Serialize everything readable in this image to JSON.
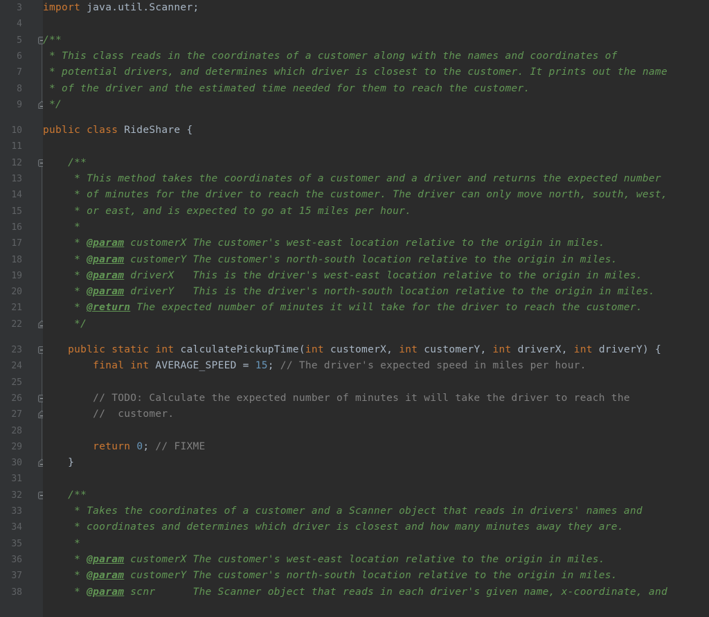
{
  "editor": {
    "language": "java",
    "theme": "darcula",
    "colors": {
      "background": "#2b2b2b",
      "gutter_background": "#313335",
      "line_number": "#606366",
      "keyword": "#cc7832",
      "identifier": "#a9b7c6",
      "number": "#6897bb",
      "javadoc": "#629755",
      "line_comment": "#808080",
      "fold_line": "#4e5254"
    },
    "first_visible_line": 3,
    "last_visible_line": 38
  },
  "gutter": {
    "line_numbers": [
      "3",
      "4",
      "5",
      "6",
      "7",
      "8",
      "9",
      "10",
      "11",
      "12",
      "13",
      "14",
      "15",
      "16",
      "17",
      "18",
      "19",
      "20",
      "21",
      "22",
      "23",
      "24",
      "25",
      "26",
      "27",
      "28",
      "29",
      "30",
      "31",
      "32",
      "33",
      "34",
      "35",
      "36",
      "37",
      "38"
    ],
    "fold_markers": [
      {
        "line": "5",
        "type": "fold-collapse-icon"
      },
      {
        "line": "9",
        "type": "fold-end-icon"
      },
      {
        "line": "12",
        "type": "fold-collapse-icon"
      },
      {
        "line": "22",
        "type": "fold-end-icon"
      },
      {
        "line": "23",
        "type": "fold-collapse-icon"
      },
      {
        "line": "26",
        "type": "fold-collapse-icon"
      },
      {
        "line": "27",
        "type": "fold-end-icon"
      },
      {
        "line": "30",
        "type": "fold-end-icon"
      },
      {
        "line": "32",
        "type": "fold-collapse-icon"
      }
    ]
  },
  "code": {
    "lines": [
      {
        "n": "3",
        "tokens": [
          {
            "t": "import ",
            "c": "kw"
          },
          {
            "t": "java.util.Scanner",
            "c": "id"
          },
          {
            "t": ";",
            "c": "pun"
          }
        ]
      },
      {
        "n": "4",
        "tokens": []
      },
      {
        "n": "5",
        "tokens": [
          {
            "t": "/**",
            "c": "doc"
          }
        ]
      },
      {
        "n": "6",
        "tokens": [
          {
            "t": " * This class reads in the coordinates of a customer along with the names and coordinates of",
            "c": "doc"
          }
        ]
      },
      {
        "n": "7",
        "tokens": [
          {
            "t": " * potential drivers, and determines which driver is closest to the customer. It prints out the name",
            "c": "doc"
          }
        ]
      },
      {
        "n": "8",
        "tokens": [
          {
            "t": " * of the driver and the estimated time needed for them to reach the customer.",
            "c": "doc"
          }
        ]
      },
      {
        "n": "9",
        "tokens": [
          {
            "t": " */",
            "c": "doc"
          }
        ]
      },
      {
        "n": "10",
        "tokens": [
          {
            "t": "public class ",
            "c": "kw"
          },
          {
            "t": "RideShare ",
            "c": "id"
          },
          {
            "t": "{",
            "c": "pun"
          }
        ]
      },
      {
        "n": "11",
        "tokens": []
      },
      {
        "n": "12",
        "tokens": [
          {
            "t": "    /**",
            "c": "doc"
          }
        ]
      },
      {
        "n": "13",
        "tokens": [
          {
            "t": "     * This method takes the coordinates of a customer and a driver and returns the expected number",
            "c": "doc"
          }
        ]
      },
      {
        "n": "14",
        "tokens": [
          {
            "t": "     * of minutes for the driver to reach the customer. The driver can only move north, south, west,",
            "c": "doc"
          }
        ]
      },
      {
        "n": "15",
        "tokens": [
          {
            "t": "     * or east, and is expected to go at 15 miles per hour.",
            "c": "doc"
          }
        ]
      },
      {
        "n": "16",
        "tokens": [
          {
            "t": "     *",
            "c": "doc"
          }
        ]
      },
      {
        "n": "17",
        "tokens": [
          {
            "t": "     * ",
            "c": "doc"
          },
          {
            "t": "@param",
            "c": "doctag"
          },
          {
            "t": " customerX The customer's west-east location relative to the origin in miles.",
            "c": "doc"
          }
        ]
      },
      {
        "n": "18",
        "tokens": [
          {
            "t": "     * ",
            "c": "doc"
          },
          {
            "t": "@param",
            "c": "doctag"
          },
          {
            "t": " customerY The customer's north-south location relative to the origin in miles.",
            "c": "doc"
          }
        ]
      },
      {
        "n": "19",
        "tokens": [
          {
            "t": "     * ",
            "c": "doc"
          },
          {
            "t": "@param",
            "c": "doctag"
          },
          {
            "t": " driverX   This is the driver's west-east location relative to the origin in miles.",
            "c": "doc"
          }
        ]
      },
      {
        "n": "20",
        "tokens": [
          {
            "t": "     * ",
            "c": "doc"
          },
          {
            "t": "@param",
            "c": "doctag"
          },
          {
            "t": " driverY   This is the driver's north-south location relative to the origin in miles.",
            "c": "doc"
          }
        ]
      },
      {
        "n": "21",
        "tokens": [
          {
            "t": "     * ",
            "c": "doc"
          },
          {
            "t": "@return",
            "c": "doctag"
          },
          {
            "t": " The expected number of minutes it will take for the driver to reach the customer.",
            "c": "doc"
          }
        ]
      },
      {
        "n": "22",
        "tokens": [
          {
            "t": "     */",
            "c": "doc"
          }
        ]
      },
      {
        "n": "23",
        "tokens": [
          {
            "t": "    ",
            "c": "pun"
          },
          {
            "t": "public static int ",
            "c": "kw"
          },
          {
            "t": "calculatePickupTime",
            "c": "id"
          },
          {
            "t": "(",
            "c": "pun"
          },
          {
            "t": "int ",
            "c": "kw"
          },
          {
            "t": "customerX",
            "c": "id"
          },
          {
            "t": ", ",
            "c": "pun"
          },
          {
            "t": "int ",
            "c": "kw"
          },
          {
            "t": "customerY",
            "c": "id"
          },
          {
            "t": ", ",
            "c": "pun"
          },
          {
            "t": "int ",
            "c": "kw"
          },
          {
            "t": "driverX",
            "c": "id"
          },
          {
            "t": ", ",
            "c": "pun"
          },
          {
            "t": "int ",
            "c": "kw"
          },
          {
            "t": "driverY",
            "c": "id"
          },
          {
            "t": ") {",
            "c": "pun"
          }
        ]
      },
      {
        "n": "24",
        "tokens": [
          {
            "t": "        ",
            "c": "pun"
          },
          {
            "t": "final int ",
            "c": "kw"
          },
          {
            "t": "AVERAGE_SPEED ",
            "c": "id"
          },
          {
            "t": "= ",
            "c": "pun"
          },
          {
            "t": "15",
            "c": "num"
          },
          {
            "t": "; ",
            "c": "pun"
          },
          {
            "t": "// The driver's expected speed in miles per hour.",
            "c": "cmt"
          }
        ]
      },
      {
        "n": "25",
        "tokens": []
      },
      {
        "n": "26",
        "tokens": [
          {
            "t": "        ",
            "c": "pun"
          },
          {
            "t": "// TODO: Calculate the expected number of minutes it will take the driver to reach the",
            "c": "cmt"
          }
        ]
      },
      {
        "n": "27",
        "tokens": [
          {
            "t": "        ",
            "c": "pun"
          },
          {
            "t": "//  customer.",
            "c": "cmt"
          }
        ]
      },
      {
        "n": "28",
        "tokens": []
      },
      {
        "n": "29",
        "tokens": [
          {
            "t": "        ",
            "c": "pun"
          },
          {
            "t": "return ",
            "c": "kw"
          },
          {
            "t": "0",
            "c": "num"
          },
          {
            "t": "; ",
            "c": "pun"
          },
          {
            "t": "// FIXME",
            "c": "cmt"
          }
        ]
      },
      {
        "n": "30",
        "tokens": [
          {
            "t": "    }",
            "c": "pun"
          }
        ]
      },
      {
        "n": "31",
        "tokens": []
      },
      {
        "n": "32",
        "tokens": [
          {
            "t": "    /**",
            "c": "doc"
          }
        ]
      },
      {
        "n": "33",
        "tokens": [
          {
            "t": "     * Takes the coordinates of a customer and a Scanner object that reads in drivers' names and",
            "c": "doc"
          }
        ]
      },
      {
        "n": "34",
        "tokens": [
          {
            "t": "     * coordinates and determines which driver is closest and how many minutes away they are.",
            "c": "doc"
          }
        ]
      },
      {
        "n": "35",
        "tokens": [
          {
            "t": "     *",
            "c": "doc"
          }
        ]
      },
      {
        "n": "36",
        "tokens": [
          {
            "t": "     * ",
            "c": "doc"
          },
          {
            "t": "@param",
            "c": "doctag"
          },
          {
            "t": " customerX The customer's west-east location relative to the origin in miles.",
            "c": "doc"
          }
        ]
      },
      {
        "n": "37",
        "tokens": [
          {
            "t": "     * ",
            "c": "doc"
          },
          {
            "t": "@param",
            "c": "doctag"
          },
          {
            "t": " customerY The customer's north-south location relative to the origin in miles.",
            "c": "doc"
          }
        ]
      },
      {
        "n": "38",
        "tokens": [
          {
            "t": "     * ",
            "c": "doc"
          },
          {
            "t": "@param",
            "c": "doctag"
          },
          {
            "t": " scnr      The Scanner object that reads in each driver's given name, x-coordinate, and",
            "c": "doc"
          }
        ]
      }
    ]
  }
}
